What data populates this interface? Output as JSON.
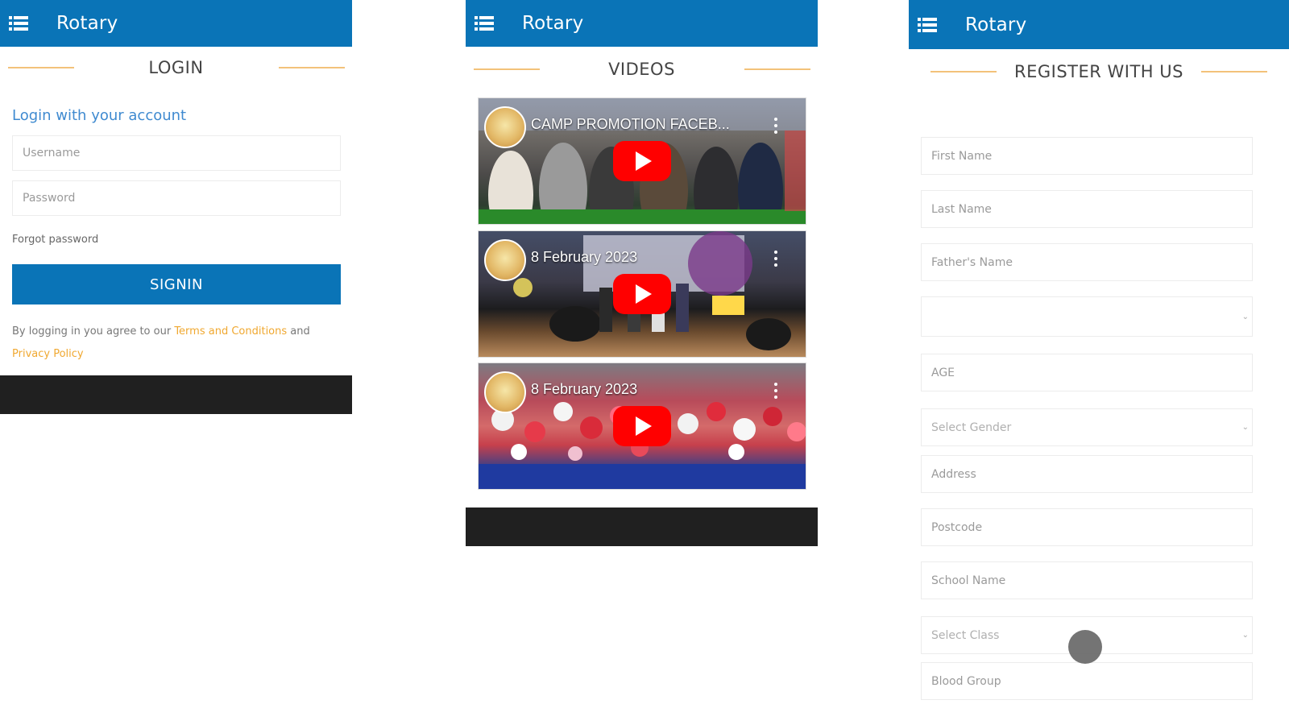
{
  "colors": {
    "appbar": "#0a74b7",
    "accent_line": "#f3c27a",
    "link_blue": "#3f8ad0",
    "link_orange": "#f0a830",
    "bottom_bar": "#202020",
    "play_button": "#ff0000"
  },
  "login_screen": {
    "app_title": "Rotary",
    "menu_icon": "menu-list-icon",
    "heading": "LOGIN",
    "subheading": "Login with your account",
    "username_placeholder": "Username",
    "password_placeholder": "Password",
    "forgot_password": "Forgot password",
    "signin_label": "SIGNIN",
    "terms_prefix": "By logging in you agree to our",
    "terms_link": "Terms and Conditions",
    "terms_and": "and",
    "privacy_link": "Privacy Policy"
  },
  "videos_screen": {
    "app_title": "Rotary",
    "menu_icon": "menu-list-icon",
    "heading": "VIDEOS",
    "videos": [
      {
        "title": "CAMP PROMOTION FACEB...",
        "icon": "youtube-play-icon"
      },
      {
        "title": "8 February 2023",
        "icon": "youtube-play-icon"
      },
      {
        "title": "8 February 2023",
        "icon": "youtube-play-icon"
      }
    ]
  },
  "register_screen": {
    "app_title": "Rotary",
    "menu_icon": "menu-list-icon",
    "heading": "REGISTER WITH US",
    "fields": {
      "first_name": "First Name",
      "last_name": "Last Name",
      "fathers_name": "Father's Name",
      "blank_select": "",
      "age": "AGE",
      "gender": "Select Gender",
      "address": "Address",
      "postcode": "Postcode",
      "school_name": "School Name",
      "class": "Select Class",
      "blood_group": "Blood Group"
    }
  }
}
